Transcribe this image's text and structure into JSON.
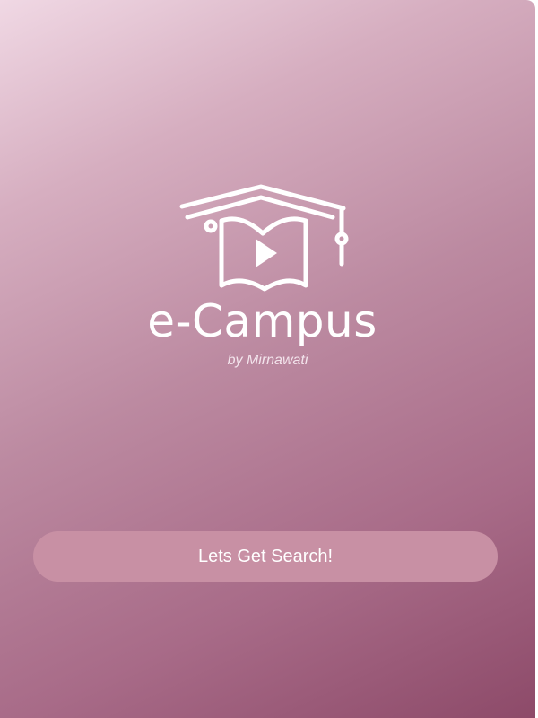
{
  "app": {
    "logo_icon": "graduation-cap-play-book-icon",
    "name": "e-Campus",
    "byline": "by Mirnawati"
  },
  "actions": {
    "primary_label": "Lets Get Search!"
  },
  "colors": {
    "gradient_start": "#f0d8e4",
    "gradient_end": "#8d4a69",
    "button": "#c890a4",
    "text": "#ffffff"
  }
}
